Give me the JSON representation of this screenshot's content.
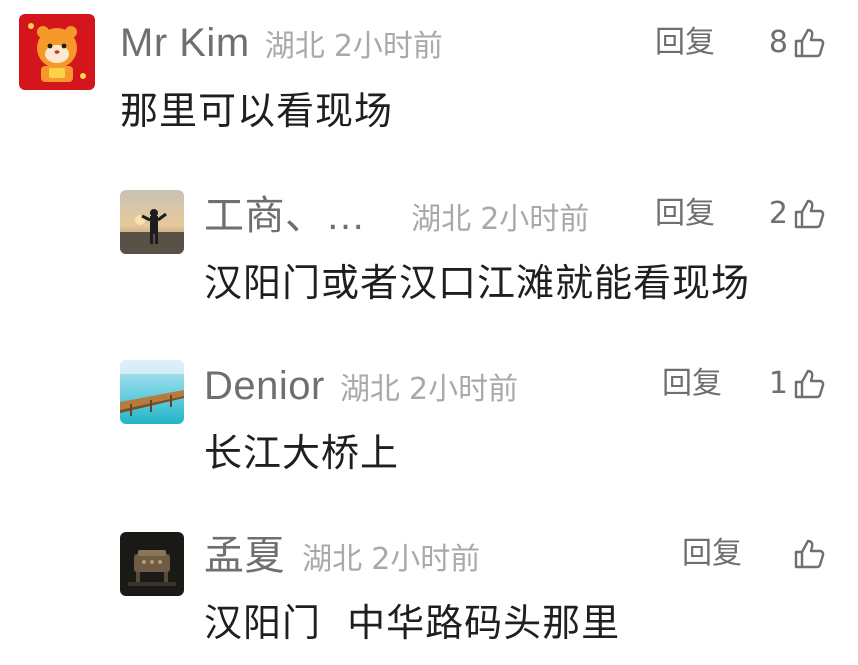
{
  "comments": [
    {
      "name": "Mr Kim",
      "location": "湖北",
      "time": "2小时前",
      "reply_label": "回复",
      "likes": "8",
      "text": "那里可以看现场",
      "avatar_icon": "orange-tiger-cartoon-avatar"
    },
    {
      "name": "工商、…",
      "location": "湖北",
      "time": "2小时前",
      "reply_label": "回复",
      "likes": "2",
      "text": "汉阳门或者汉口江滩就能看现场",
      "avatar_icon": "person-at-sunset-photo-avatar"
    },
    {
      "name": "Denior",
      "location": "湖北",
      "time": "2小时前",
      "reply_label": "回复",
      "likes": "1",
      "text": "长江大桥上",
      "avatar_icon": "sea-pier-photo-avatar"
    },
    {
      "name": "孟夏",
      "location": "湖北",
      "time": "2小时前",
      "reply_label": "回复",
      "likes": "",
      "text": "汉阳门  中华路码头那里",
      "avatar_icon": "dark-antique-object-avatar"
    }
  ],
  "colors": {
    "name": "#6f6f6f",
    "meta": "#a9a9a9",
    "text": "#1f1f1f",
    "avatar_red": "#d4151b"
  }
}
